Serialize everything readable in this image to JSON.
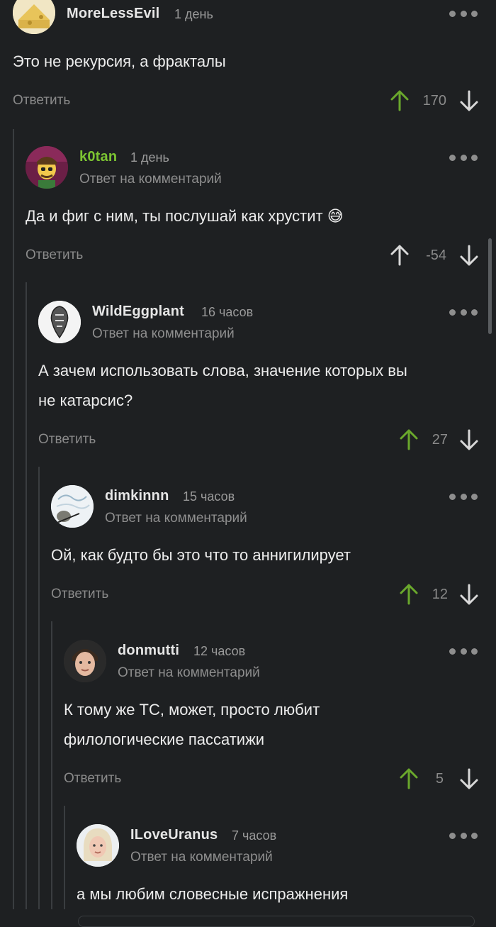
{
  "colors": {
    "background": "#1e2022",
    "upvote_active": "#6aa82c",
    "upvote_inactive": "#8e8e8e",
    "author_green": "#7cc432",
    "muted": "#8e8e8e"
  },
  "common": {
    "reply_label": "Ответить",
    "reply_to_label": "Ответ на комментарий",
    "menu_icon": "more-dots-icon",
    "upvote_icon": "arrow-up-icon",
    "downvote_icon": "arrow-down-icon"
  },
  "comments": [
    {
      "author": "MoreLessEvil",
      "time": "1 день",
      "text": "Это не рекурсия, а фракталы",
      "score": "170",
      "upvoted": true
    },
    {
      "author": "k0tan",
      "time": "1 день",
      "text": "Да и фиг с ним, ты послушай как хрустит 😅",
      "score": "-54",
      "upvoted": false
    },
    {
      "author": "WildEggplant",
      "time": "16 часов",
      "text_line1": "А зачем использовать слова, значение которых вы",
      "text_line2": "не катарсис?",
      "score": "27",
      "upvoted": true
    },
    {
      "author": "dimkinnn",
      "time": "15 часов",
      "text": "Ой, как будто бы это что то аннигилирует",
      "score": "12",
      "upvoted": true
    },
    {
      "author": "donmutti",
      "time": "12 часов",
      "text_line1": "К тому же ТС, может, просто любит",
      "text_line2": "филологические пассатижи",
      "score": "5",
      "upvoted": true
    },
    {
      "author": "ILoveUranus",
      "time": "7 часов",
      "text": "а мы любим словесные испражнения"
    }
  ]
}
